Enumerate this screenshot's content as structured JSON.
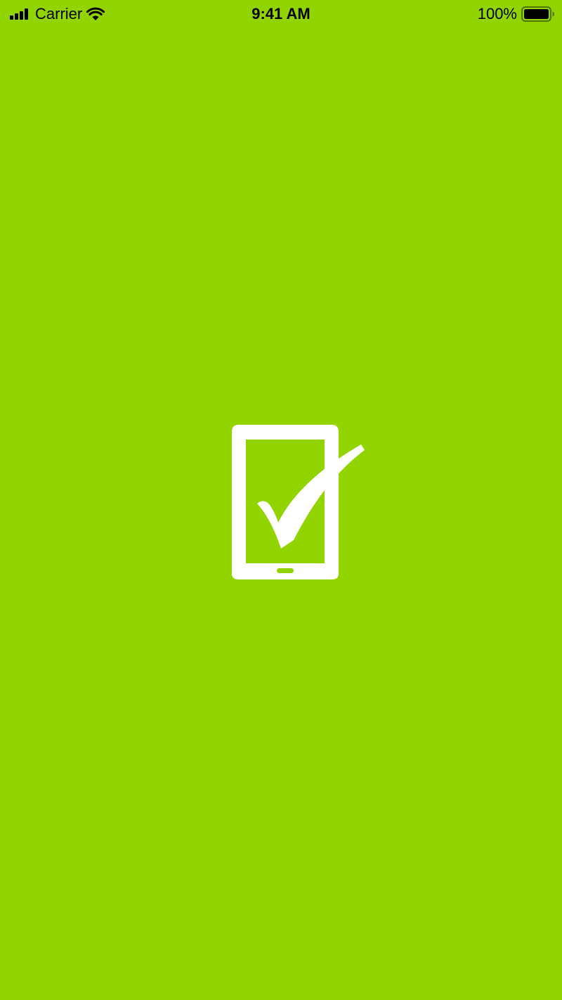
{
  "status_bar": {
    "carrier": "Carrier",
    "time": "9:41 AM",
    "battery_percent": "100%",
    "icons": {
      "signal": "cellular-signal-icon",
      "wifi": "wifi-icon",
      "battery": "battery-icon"
    }
  },
  "splash": {
    "logo_icon": "tablet-checkmark-icon",
    "background_color": "#92D400",
    "logo_color": "#FFFFFF"
  }
}
